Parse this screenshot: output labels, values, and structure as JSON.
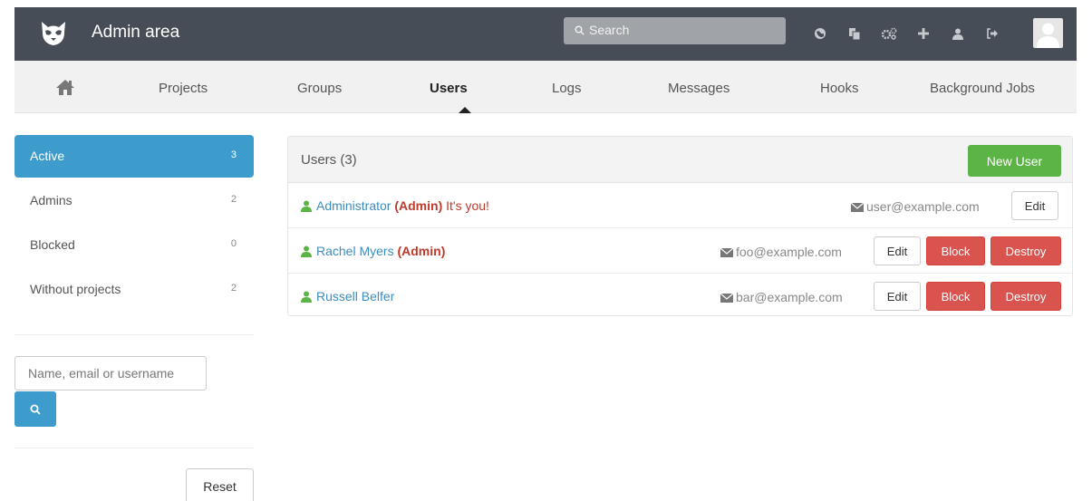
{
  "header": {
    "title": "Admin area",
    "search_placeholder": "Search",
    "icons": [
      "globe-icon",
      "copy-icon",
      "cogs-icon",
      "plus-icon",
      "user-icon",
      "sign-out-icon"
    ]
  },
  "nav": {
    "items": [
      {
        "label": "Projects"
      },
      {
        "label": "Groups"
      },
      {
        "label": "Users"
      },
      {
        "label": "Logs"
      },
      {
        "label": "Messages"
      },
      {
        "label": "Hooks"
      },
      {
        "label": "Background Jobs"
      }
    ],
    "active": "Users"
  },
  "sidebar": {
    "filters": [
      {
        "label": "Active",
        "count": "3"
      },
      {
        "label": "Admins",
        "count": "2"
      },
      {
        "label": "Blocked",
        "count": "0"
      },
      {
        "label": "Without projects",
        "count": "2"
      }
    ],
    "search_placeholder": "Name, email or username",
    "reset_label": "Reset"
  },
  "users_panel": {
    "title": "Users (3)",
    "new_user_label": "New User",
    "rows": [
      {
        "name": "Administrator",
        "admin_label": "(Admin)",
        "note": "It's you!",
        "email": "user@example.com",
        "edit_label": "Edit"
      },
      {
        "name": "Rachel Myers",
        "admin_label": "(Admin)",
        "email": "foo@example.com",
        "edit_label": "Edit",
        "block_label": "Block",
        "destroy_label": "Destroy"
      },
      {
        "name": "Russell Belfer",
        "email": "bar@example.com",
        "edit_label": "Edit",
        "block_label": "Block",
        "destroy_label": "Destroy"
      }
    ]
  },
  "colors": {
    "topbar": "#474d57",
    "active_blue": "#3d9ccc",
    "success_green": "#5cb346",
    "danger_red": "#d9534f",
    "link_blue": "#3c8dbc",
    "admin_red": "#c0392b"
  }
}
